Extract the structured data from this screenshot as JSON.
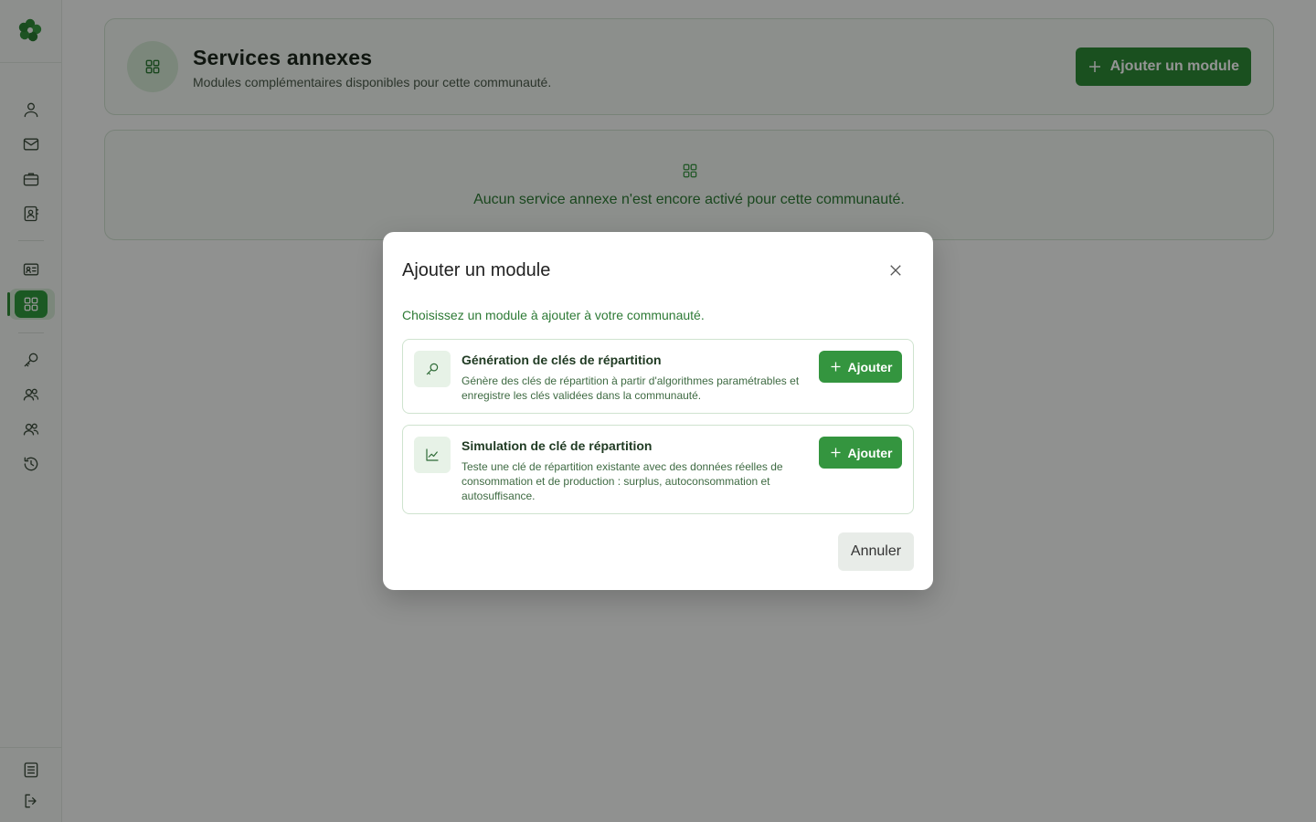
{
  "header": {
    "title": "Services annexes",
    "subtitle": "Modules complémentaires disponibles pour cette communauté.",
    "add_button_label": "Ajouter un module"
  },
  "empty_state": {
    "message": "Aucun service annexe n'est encore activé pour cette communauté."
  },
  "sidebar": {
    "items": [
      {
        "icon": "user-icon"
      },
      {
        "icon": "mail-icon"
      },
      {
        "icon": "briefcase-icon"
      },
      {
        "icon": "contact-book-icon"
      },
      {
        "icon": "id-card-icon"
      },
      {
        "icon": "grid-icon",
        "active": true
      },
      {
        "icon": "key-icon"
      },
      {
        "icon": "users-icon"
      },
      {
        "icon": "users-icon"
      },
      {
        "icon": "history-icon"
      },
      {
        "icon": "document-icon"
      },
      {
        "icon": "logout-icon"
      }
    ]
  },
  "modal": {
    "title": "Ajouter un module",
    "description": "Choisissez un module à ajouter à votre communauté.",
    "modules": [
      {
        "icon": "key-icon",
        "title": "Génération de clés de répartition",
        "description": "Génère des clés de répartition à partir d'algorithmes paramétrables et enregistre les clés validées dans la communauté.",
        "button_label": "Ajouter"
      },
      {
        "icon": "chart-line-icon",
        "title": "Simulation de clé de répartition",
        "description": "Teste une clé de répartition existante avec des données réelles de consommation et de production : surplus, autoconsommation et autosuffisance.",
        "button_label": "Ajouter"
      }
    ],
    "cancel_label": "Annuler"
  },
  "colors": {
    "primary": "#2e8b36",
    "primary_light": "#d5e8d5",
    "text_green": "#2d7a35"
  }
}
